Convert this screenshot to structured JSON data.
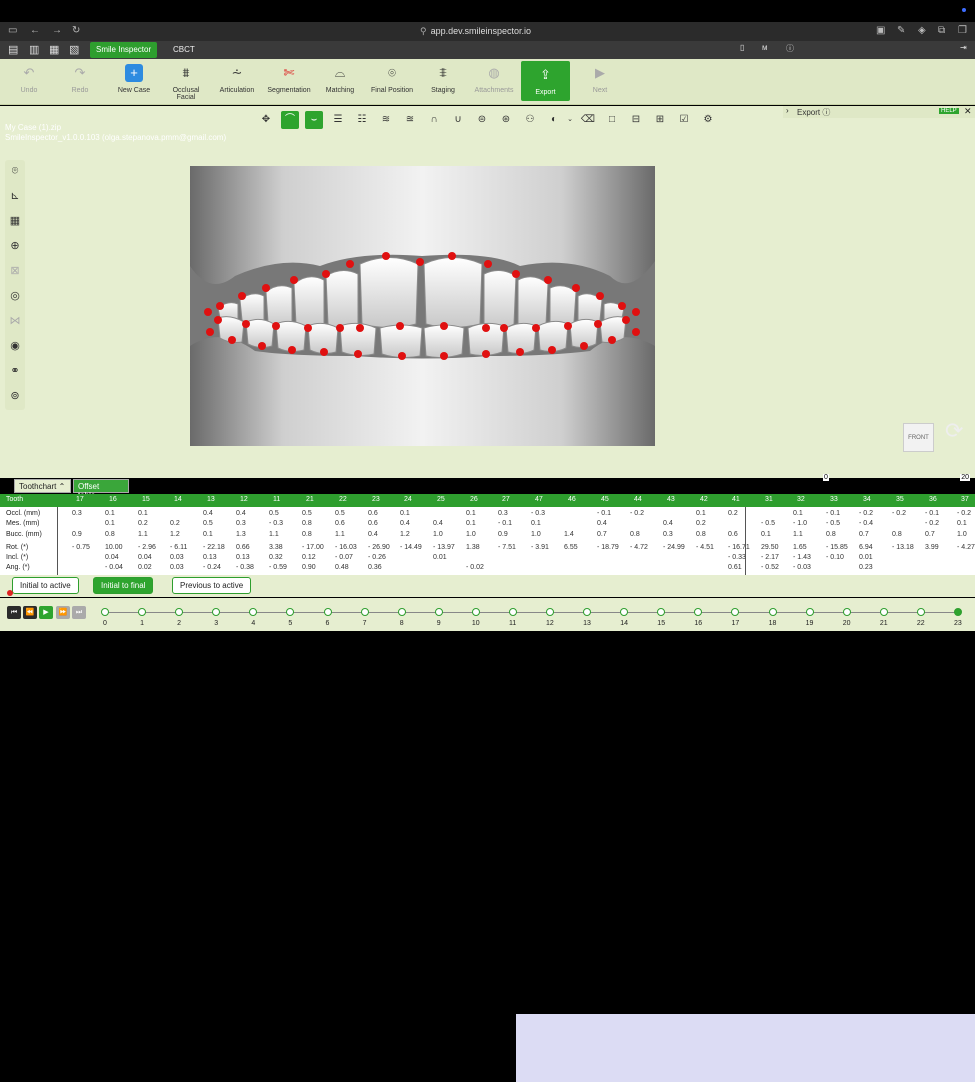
{
  "browser": {
    "url": "app.dev.smileinspector.io"
  },
  "app": {
    "tabs": [
      "Smile Inspector",
      "CBCT"
    ]
  },
  "toolbar": {
    "items": [
      {
        "label": "Undo",
        "icon": "undo-icon",
        "disabled": true
      },
      {
        "label": "Redo",
        "icon": "redo-icon",
        "disabled": true
      },
      {
        "label": "New Case",
        "icon": "new-case-icon"
      },
      {
        "label": "Occlusal Facial",
        "icon": "occlusal-facial-icon"
      },
      {
        "label": "Articulation",
        "icon": "articulation-icon"
      },
      {
        "label": "Segmentation",
        "icon": "segmentation-icon"
      },
      {
        "label": "Matching",
        "icon": "matching-icon"
      },
      {
        "label": "Final Position",
        "icon": "final-position-icon"
      },
      {
        "label": "Staging",
        "icon": "staging-icon"
      },
      {
        "label": "Attachments",
        "icon": "attachments-icon",
        "disabled": true
      },
      {
        "label": "Export",
        "icon": "export-icon",
        "active": true
      },
      {
        "label": "Next",
        "icon": "next-icon",
        "disabled": true
      }
    ]
  },
  "case": {
    "file": "My Case (1).zip",
    "version": "SmileInspector_v1.0.0.103 (olga.stepanova.pmm@gmail.com)"
  },
  "export_panel": {
    "label": "Export",
    "help": "HELP"
  },
  "view": {
    "front_label": "FRONT"
  },
  "slider": {
    "min": "0",
    "max": "20"
  },
  "subtabs": [
    "Toothchart",
    "Offset table"
  ],
  "table": {
    "header_label": "Tooth",
    "teeth": [
      "17",
      "16",
      "15",
      "14",
      "13",
      "12",
      "11",
      "21",
      "22",
      "23",
      "24",
      "25",
      "26",
      "27",
      "47",
      "46",
      "45",
      "44",
      "43",
      "42",
      "41",
      "31",
      "32",
      "33",
      "34",
      "35",
      "36",
      "37"
    ],
    "row_labels": [
      "Occl. (mm)",
      "Mes. (mm)",
      "Bucc. (mm)",
      "Rot. (*)",
      "Incl. (*)",
      "Ang. (*)"
    ],
    "rows": [
      [
        "0.3",
        "0.1",
        "0.1",
        "",
        "0.4",
        "0.4",
        "0.5",
        "0.5",
        "0.5",
        "0.6",
        "0.1",
        "",
        "0.1",
        "0.3",
        "- 0.3",
        "",
        "- 0.1",
        "- 0.2",
        "",
        "0.1",
        "0.2",
        "",
        "0.1",
        "- 0.1",
        "- 0.2",
        "- 0.2",
        "- 0.1",
        "- 0.2"
      ],
      [
        "",
        "0.1",
        "0.2",
        "0.2",
        "0.5",
        "0.3",
        "- 0.3",
        "0.8",
        "0.6",
        "0.6",
        "0.4",
        "0.4",
        "0.1",
        "- 0.1",
        "0.1",
        "",
        "0.4",
        "",
        "0.4",
        "0.2",
        "",
        "- 0.5",
        "- 1.0",
        "- 0.5",
        "- 0.4",
        "",
        "- 0.2",
        "0.1"
      ],
      [
        "0.9",
        "0.8",
        "1.1",
        "1.2",
        "0.1",
        "1.3",
        "1.1",
        "0.8",
        "1.1",
        "0.4",
        "1.2",
        "1.0",
        "1.0",
        "0.9",
        "1.0",
        "1.4",
        "0.7",
        "0.8",
        "0.3",
        "0.8",
        "0.6",
        "0.1",
        "1.1",
        "0.8",
        "0.7",
        "0.8",
        "0.7",
        "1.0"
      ],
      [
        "- 0.75",
        "10.00",
        "- 2.96",
        "- 6.11",
        "- 22.18",
        "0.66",
        "3.38",
        "- 17.00",
        "- 16.03",
        "- 26.90",
        "- 14.49",
        "- 13.97",
        "1.38",
        "- 7.51",
        "- 3.91",
        "6.55",
        "- 18.79",
        "- 4.72",
        "- 24.99",
        "- 4.51",
        "- 16.71",
        "29.50",
        "1.65",
        "- 15.85",
        "6.94",
        "- 13.18",
        "3.99",
        "- 4.27"
      ],
      [
        "",
        "0.04",
        "0.04",
        "0.03",
        "0.13",
        "0.13",
        "0.32",
        "0.12",
        "- 0.07",
        "- 0.26",
        "",
        "0.01",
        "",
        "",
        "",
        "",
        "",
        "",
        "",
        "",
        "- 0.33",
        "- 2.17",
        "- 1.43",
        "- 0.10",
        "0.01",
        "",
        "",
        ""
      ],
      [
        "",
        "- 0.04",
        "0.02",
        "0.03",
        "- 0.24",
        "- 0.38",
        "- 0.59",
        "0.90",
        "0.48",
        "0.36",
        "",
        "",
        "- 0.02",
        "",
        "",
        "",
        "",
        "",
        "",
        "",
        "0.61",
        "- 0.52",
        "- 0.03",
        "",
        "0.23",
        "",
        "",
        ""
      ]
    ]
  },
  "actions": [
    "Initial to active",
    "Initial to final",
    "Previous to active"
  ],
  "timeline": {
    "stages": [
      "0",
      "1",
      "2",
      "3",
      "4",
      "5",
      "6",
      "7",
      "8",
      "9",
      "10",
      "11",
      "12",
      "13",
      "14",
      "15",
      "16",
      "17",
      "18",
      "19",
      "20",
      "21",
      "22",
      "23"
    ],
    "current": 23
  },
  "colors": {
    "accent": "#2ea42e",
    "toolbar_bg": "#dfe8c6",
    "marker": "#e01010"
  }
}
